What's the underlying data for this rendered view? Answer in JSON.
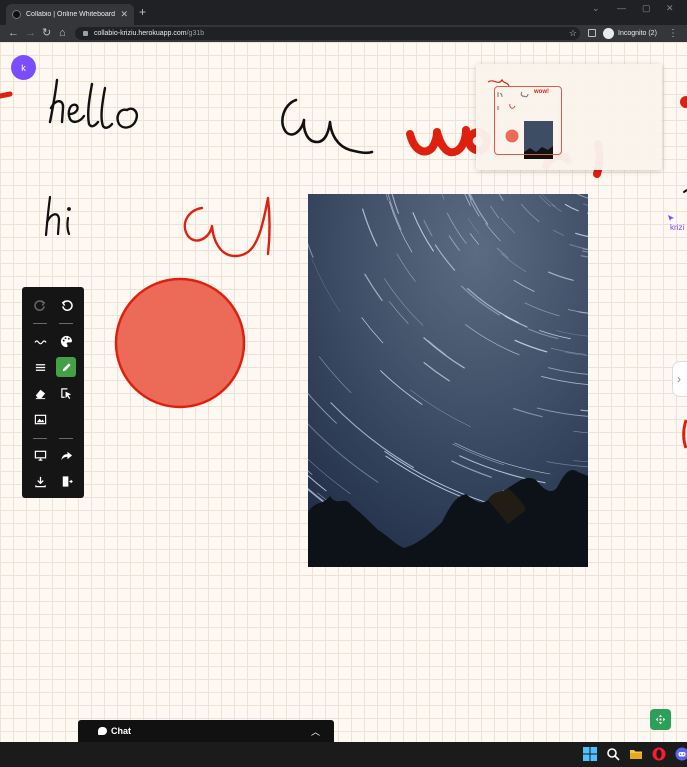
{
  "browser": {
    "tab_title": "Collabio | Online Whiteboard",
    "tab_close": "✕",
    "new_tab": "+",
    "url_host": "collabio-kriziu.herokuapp.com",
    "url_path": "/g31b",
    "incognito_label": "Incognito (2)",
    "window_controls": [
      "⌄",
      "—",
      "▢",
      "✕"
    ]
  },
  "board": {
    "user_avatar": "k",
    "remote_user_name": "krizi",
    "minimap_text": "wow!"
  },
  "tools": {
    "items": [
      "redo",
      "undo",
      "line-width",
      "color-picker",
      "line-style",
      "pencil",
      "eraser",
      "select",
      "image",
      "present",
      "share",
      "download",
      "exit"
    ],
    "active": "pencil",
    "active_color": "#43a047"
  },
  "chat": {
    "label": "Chat"
  },
  "colors": {
    "grid": "#ece2d6",
    "background": "#fdf8f1",
    "ink_black": "#111111",
    "ink_red": "#e0200f",
    "circle_fill": "#ec6a58",
    "avatar": "#7c4dff",
    "move_button": "#2e9e5b"
  }
}
